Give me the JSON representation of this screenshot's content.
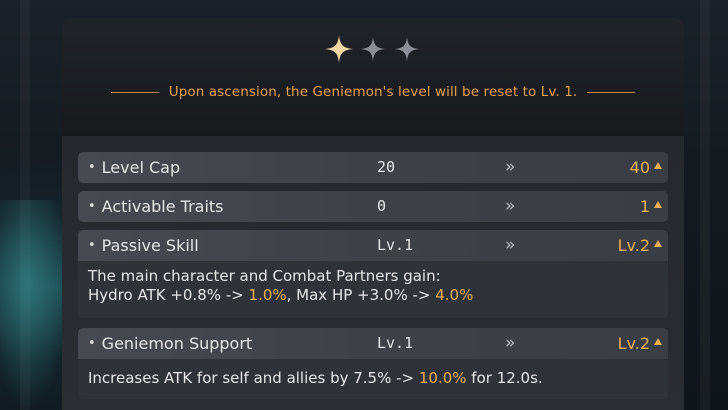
{
  "ascension": {
    "stars": [
      "filled",
      "empty",
      "empty"
    ],
    "notice": "Upon ascension, the Geniemon's level will be reset to Lv. 1."
  },
  "colors": {
    "accent": "#eeb054",
    "star_filled": "#f1d7a3",
    "star_empty": "#8b8f95"
  },
  "rows": [
    {
      "label": "Level Cap",
      "current": "20",
      "arrow": "»",
      "next": "40"
    },
    {
      "label": "Activable Traits",
      "current": "0",
      "arrow": "»",
      "next": "1"
    },
    {
      "label": "Passive Skill",
      "current": "Lv.1",
      "arrow": "»",
      "next": "Lv.2",
      "description": {
        "line1": "The main character and Combat Partners gain:",
        "line2_prefix": "Hydro ATK +0.8% -> ",
        "line2_hl1": "1.0%",
        "line2_mid": ", Max HP +3.0% -> ",
        "line2_hl2": "4.0%"
      }
    },
    {
      "label": "Geniemon Support",
      "current": "Lv.1",
      "arrow": "»",
      "next": "Lv.2",
      "description": {
        "prefix": "Increases ATK for self and allies by 7.5% -> ",
        "hl": "10.0%",
        "suffix": " for 12.0s."
      }
    }
  ]
}
